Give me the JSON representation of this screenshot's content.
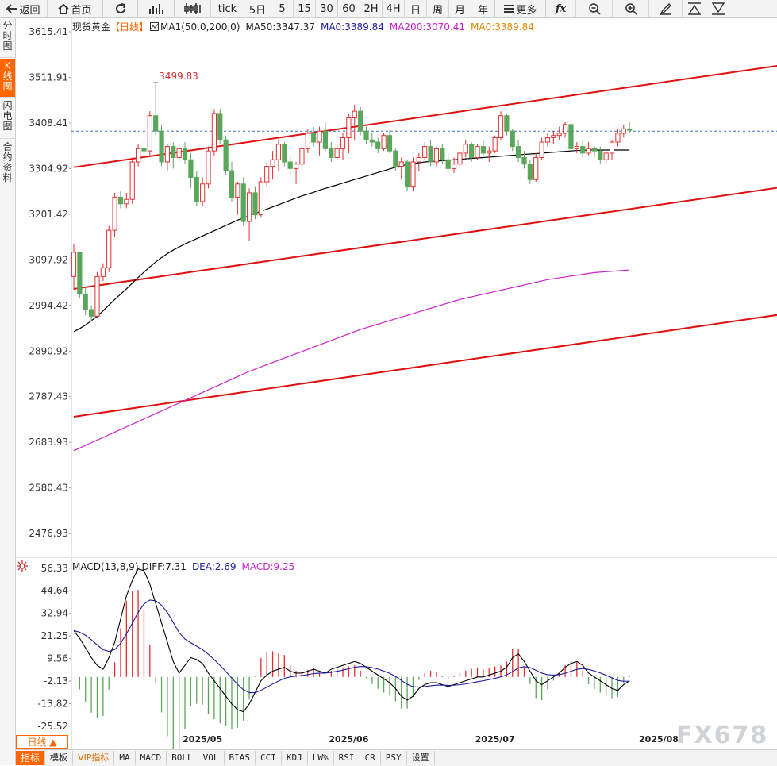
{
  "toolbar": {
    "back_label": "返回",
    "home_label": "首页",
    "tick_label": "tick",
    "periods": [
      "5日",
      "5",
      "15",
      "30",
      "60",
      "2H",
      "4H",
      "日",
      "周",
      "月",
      "年"
    ],
    "more_label": "更多",
    "fx_label": "fx"
  },
  "sidebar": {
    "tabs": [
      "分时图",
      "K线图",
      "闪电图",
      "合约资料"
    ],
    "active_index": 1
  },
  "colors": {
    "up": "#e03030",
    "down": "#5aa65a",
    "ma50": "#000000",
    "ma200": "#cc22cc",
    "trend": "#e01010",
    "diff": "#000000",
    "dea": "#1e1e9e",
    "grid": "#e0e0e0",
    "accent": "#ff6600"
  },
  "price_legend": {
    "name": "现货黄金",
    "period": "【日线】",
    "ma_label": "MA1(50,0,200,0)",
    "ma50": "MA50:3347.37",
    "ma0": "MA0:3389.84",
    "ma200": "MA200:3070.41",
    "ma0b": "MA0:3389.84"
  },
  "macd_legend": {
    "label": "MACD(13,8,9)",
    "diff": "DIFF:7.31",
    "dea": "DEA:2.69",
    "macd": "MACD:9.25"
  },
  "chart_data": [
    {
      "type": "candlestick",
      "title": "现货黄金 日线",
      "ytick_labels": [
        "3615.41",
        "3511.91",
        "3408.41",
        "3304.92",
        "3201.42",
        "3097.92",
        "2994.42",
        "2890.92",
        "2787.43",
        "2683.93",
        "2580.43",
        "2476.93"
      ],
      "ylim": [
        2425.0,
        3646.0
      ],
      "xtick_labels": [
        "2025/05",
        "2025/06",
        "2025/07",
        "2025/08"
      ],
      "xtick_index": [
        22,
        47,
        72,
        100
      ],
      "high_annotation": {
        "index": 14,
        "value": 3499.83,
        "label": "3499.83"
      },
      "last_price_line": 3389.84,
      "ohlc": [
        [
          3060,
          3135,
          3030,
          3115
        ],
        [
          3115,
          3117,
          3010,
          3020
        ],
        [
          3020,
          3035,
          2972,
          2985
        ],
        [
          2985,
          2995,
          2958,
          2970
        ],
        [
          2970,
          3070,
          2965,
          3060
        ],
        [
          3060,
          3090,
          3050,
          3080
        ],
        [
          3080,
          3175,
          3070,
          3165
        ],
        [
          3165,
          3250,
          3150,
          3240
        ],
        [
          3240,
          3255,
          3215,
          3225
        ],
        [
          3225,
          3250,
          3215,
          3235
        ],
        [
          3235,
          3330,
          3225,
          3320
        ],
        [
          3320,
          3360,
          3310,
          3350
        ],
        [
          3350,
          3370,
          3330,
          3345
        ],
        [
          3345,
          3435,
          3335,
          3425
        ],
        [
          3425,
          3500,
          3380,
          3390
        ],
        [
          3390,
          3405,
          3310,
          3320
        ],
        [
          3320,
          3360,
          3300,
          3355
        ],
        [
          3355,
          3365,
          3305,
          3330
        ],
        [
          3330,
          3355,
          3320,
          3350
        ],
        [
          3350,
          3365,
          3315,
          3325
        ],
        [
          3325,
          3340,
          3260,
          3285
        ],
        [
          3285,
          3300,
          3220,
          3230
        ],
        [
          3230,
          3285,
          3220,
          3270
        ],
        [
          3270,
          3355,
          3260,
          3345
        ],
        [
          3345,
          3440,
          3335,
          3430
        ],
        [
          3430,
          3440,
          3360,
          3370
        ],
        [
          3370,
          3380,
          3290,
          3300
        ],
        [
          3300,
          3320,
          3230,
          3240
        ],
        [
          3240,
          3275,
          3200,
          3270
        ],
        [
          3270,
          3285,
          3175,
          3185
        ],
        [
          3185,
          3260,
          3140,
          3250
        ],
        [
          3250,
          3265,
          3190,
          3200
        ],
        [
          3200,
          3285,
          3195,
          3275
        ],
        [
          3275,
          3320,
          3265,
          3310
        ],
        [
          3310,
          3345,
          3280,
          3325
        ],
        [
          3325,
          3370,
          3300,
          3360
        ],
        [
          3360,
          3365,
          3310,
          3320
        ],
        [
          3320,
          3335,
          3290,
          3305
        ],
        [
          3305,
          3320,
          3270,
          3315
        ],
        [
          3315,
          3360,
          3305,
          3350
        ],
        [
          3350,
          3395,
          3340,
          3385
        ],
        [
          3385,
          3400,
          3355,
          3365
        ],
        [
          3365,
          3400,
          3335,
          3390
        ],
        [
          3390,
          3410,
          3345,
          3350
        ],
        [
          3350,
          3365,
          3320,
          3330
        ],
        [
          3330,
          3360,
          3325,
          3350
        ],
        [
          3350,
          3385,
          3325,
          3375
        ],
        [
          3375,
          3430,
          3340,
          3420
        ],
        [
          3420,
          3450,
          3370,
          3435
        ],
        [
          3435,
          3445,
          3380,
          3390
        ],
        [
          3390,
          3400,
          3360,
          3370
        ],
        [
          3370,
          3385,
          3355,
          3365
        ],
        [
          3365,
          3375,
          3340,
          3350
        ],
        [
          3350,
          3385,
          3345,
          3380
        ],
        [
          3380,
          3390,
          3340,
          3345
        ],
        [
          3345,
          3350,
          3300,
          3310
        ],
        [
          3310,
          3330,
          3280,
          3320
        ],
        [
          3320,
          3325,
          3255,
          3265
        ],
        [
          3265,
          3330,
          3255,
          3320
        ],
        [
          3320,
          3340,
          3300,
          3330
        ],
        [
          3330,
          3365,
          3325,
          3355
        ],
        [
          3355,
          3370,
          3310,
          3320
        ],
        [
          3320,
          3355,
          3310,
          3350
        ],
        [
          3350,
          3360,
          3315,
          3325
        ],
        [
          3325,
          3340,
          3295,
          3305
        ],
        [
          3305,
          3330,
          3295,
          3315
        ],
        [
          3315,
          3345,
          3305,
          3340
        ],
        [
          3340,
          3370,
          3330,
          3360
        ],
        [
          3360,
          3365,
          3320,
          3330
        ],
        [
          3330,
          3360,
          3325,
          3355
        ],
        [
          3355,
          3370,
          3335,
          3340
        ],
        [
          3340,
          3355,
          3320,
          3345
        ],
        [
          3345,
          3380,
          3340,
          3375
        ],
        [
          3375,
          3435,
          3370,
          3425
        ],
        [
          3425,
          3430,
          3380,
          3390
        ],
        [
          3390,
          3395,
          3345,
          3355
        ],
        [
          3355,
          3370,
          3320,
          3330
        ],
        [
          3330,
          3345,
          3305,
          3315
        ],
        [
          3315,
          3325,
          3270,
          3280
        ],
        [
          3280,
          3340,
          3275,
          3330
        ],
        [
          3330,
          3375,
          3325,
          3365
        ],
        [
          3365,
          3385,
          3355,
          3375
        ],
        [
          3375,
          3390,
          3360,
          3380
        ],
        [
          3380,
          3400,
          3370,
          3385
        ],
        [
          3385,
          3410,
          3375,
          3405
        ],
        [
          3405,
          3415,
          3340,
          3350
        ],
        [
          3350,
          3365,
          3340,
          3355
        ],
        [
          3355,
          3370,
          3330,
          3340
        ],
        [
          3340,
          3365,
          3335,
          3350
        ],
        [
          3350,
          3355,
          3330,
          3345
        ],
        [
          3345,
          3355,
          3315,
          3325
        ],
        [
          3325,
          3345,
          3315,
          3340
        ],
        [
          3340,
          3370,
          3325,
          3365
        ],
        [
          3365,
          3395,
          3355,
          3385
        ],
        [
          3385,
          3405,
          3375,
          3395
        ],
        [
          3395,
          3410,
          3385,
          3392
        ]
      ],
      "series": [
        {
          "name": "MA50",
          "values": [
            2935,
            2942,
            2950,
            2960,
            2970,
            2982,
            2995,
            3008,
            3020,
            3032,
            3045,
            3058,
            3070,
            3082,
            3093,
            3103,
            3112,
            3120,
            3127,
            3134,
            3140,
            3146,
            3152,
            3158,
            3164,
            3170,
            3176,
            3182,
            3188,
            3193,
            3198,
            3203,
            3208,
            3213,
            3218,
            3223,
            3228,
            3233,
            3238,
            3243,
            3247,
            3251,
            3256,
            3260,
            3264,
            3268,
            3272,
            3276,
            3280,
            3284,
            3288,
            3292,
            3296,
            3300,
            3304,
            3308,
            3311,
            3314,
            3316,
            3318,
            3320,
            3321,
            3322,
            3323,
            3324,
            3325,
            3326,
            3327,
            3328,
            3329,
            3330,
            3331,
            3332,
            3333,
            3334,
            3335,
            3336,
            3337,
            3338,
            3339,
            3340,
            3341,
            3342,
            3343,
            3344,
            3345,
            3346,
            3346,
            3347,
            3347,
            3347,
            3347,
            3347,
            3347,
            3347,
            3347
          ]
        },
        {
          "name": "MA200",
          "values": [
            2665,
            2671,
            2677,
            2683,
            2689,
            2695,
            2701,
            2707,
            2713,
            2719,
            2725,
            2731,
            2737,
            2743,
            2749,
            2755,
            2761,
            2767,
            2773,
            2779,
            2785,
            2791,
            2797,
            2803,
            2809,
            2815,
            2821,
            2827,
            2833,
            2839,
            2845,
            2850,
            2855,
            2860,
            2865,
            2870,
            2875,
            2880,
            2885,
            2890,
            2895,
            2900,
            2905,
            2910,
            2915,
            2920,
            2925,
            2930,
            2935,
            2940,
            2944,
            2948,
            2952,
            2956,
            2960,
            2964,
            2968,
            2972,
            2976,
            2980,
            2984,
            2988,
            2992,
            2996,
            3000,
            3004,
            3008,
            3011,
            3014,
            3017,
            3020,
            3023,
            3026,
            3029,
            3032,
            3035,
            3038,
            3041,
            3044,
            3047,
            3050,
            3053,
            3055,
            3057,
            3059,
            3061,
            3063,
            3065,
            3067,
            3069,
            3070,
            3071,
            3072,
            3073,
            3074,
            3075
          ]
        },
        {
          "name": "TrendUpper",
          "x": [
            0,
            150
          ],
          "values": [
            3308,
            3595
          ]
        },
        {
          "name": "TrendMiddle",
          "x": [
            0,
            150
          ],
          "values": [
            3032,
            3318
          ]
        },
        {
          "name": "TrendLower",
          "x": [
            0,
            150
          ],
          "values": [
            2742,
            3030
          ]
        }
      ]
    },
    {
      "type": "macd",
      "title": "MACD(13,8,9)",
      "ytick_labels": [
        "56.33",
        "44.64",
        "32.94",
        "21.25",
        "9.56",
        "-2.13",
        "-13.82",
        "-25.52"
      ],
      "ylim": [
        -37.5,
        62.0
      ],
      "diff": [
        24,
        20,
        15,
        10,
        6,
        4,
        10,
        18,
        30,
        42,
        50,
        56,
        55,
        48,
        38,
        28,
        18,
        8,
        2,
        6,
        10,
        9,
        7,
        2,
        -2,
        -6,
        -10,
        -14,
        -17,
        -18,
        -14,
        -8,
        -2,
        1,
        3,
        4,
        5,
        3,
        2,
        2,
        3,
        4,
        3,
        2,
        4,
        5,
        6,
        7,
        8,
        7,
        5,
        3,
        1,
        -1,
        -3,
        -6,
        -10,
        -12,
        -10,
        -6,
        -4,
        -3,
        -3,
        -4,
        -5,
        -4,
        -3,
        -2,
        -1,
        0,
        0,
        1,
        2,
        3,
        5,
        10,
        12,
        8,
        3,
        -2,
        -4,
        -2,
        0,
        2,
        5,
        7,
        8,
        6,
        2,
        0,
        -2,
        -4,
        -6,
        -7,
        -4,
        -2
      ]
    }
  ],
  "bottom_bar": {
    "daily_label": "日线 ▲",
    "tabs": [
      "指标",
      "模板",
      "VIP指标",
      "MA",
      "MACD",
      "BOLL",
      "VOL",
      "BIAS",
      "CCI",
      "KDJ",
      "LW%",
      "RSI",
      "CR",
      "PSY",
      "设置"
    ]
  },
  "watermark": "FX678"
}
